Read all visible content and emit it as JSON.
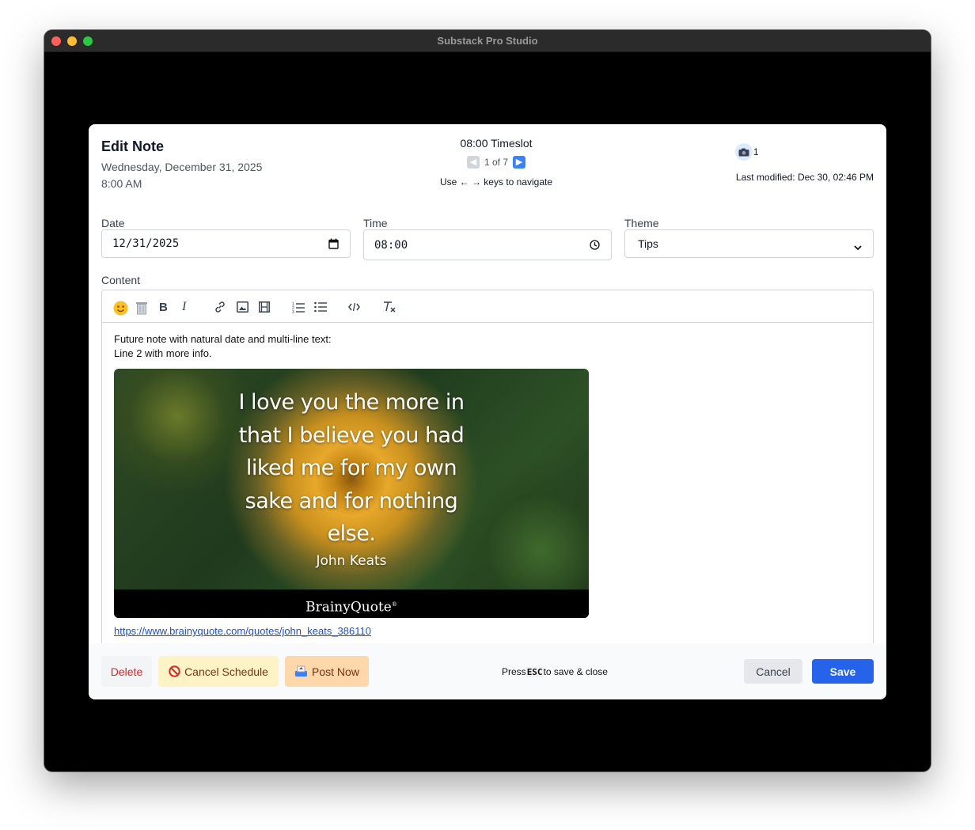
{
  "window": {
    "title": "Substack Pro Studio"
  },
  "header": {
    "title": "Edit Note",
    "date_line": "Wednesday, December 31, 2025",
    "time_line": "8:00 AM",
    "timeslot": "08:00 Timeslot",
    "position": "1 of 7",
    "nav_hint": "Use ← → keys to navigate",
    "media_count": "1",
    "last_modified": "Last modified: Dec 30, 02:46 PM"
  },
  "form": {
    "date_label": "Date",
    "date_value": "12/31/2025",
    "time_label": "Time",
    "time_value": "08:00",
    "theme_label": "Theme",
    "theme_value": "Tips",
    "content_label": "Content"
  },
  "editor": {
    "toolbar": [
      "emoji",
      "delete-image",
      "bold",
      "italic",
      "link",
      "image",
      "video",
      "ordered-list",
      "bullet-list",
      "code",
      "clear-format"
    ],
    "line1": "Future note with natural date and multi-line text:",
    "line2": "Line 2 with more info.",
    "image": {
      "quote_lines": [
        "I love you the more in",
        "that I believe you had",
        "liked me for my own",
        "sake and for nothing",
        "else."
      ],
      "author": "John Keats",
      "brand": "BrainyQuote"
    },
    "link": "https://www.brainyquote.com/quotes/john_keats_386110"
  },
  "footer": {
    "delete": "Delete",
    "cancel_schedule": "Cancel Schedule",
    "post_now": "Post Now",
    "hint_prefix": "Press",
    "hint_key": "ESC",
    "hint_suffix": "to save & close",
    "cancel": "Cancel",
    "save": "Save"
  },
  "colors": {
    "primary": "#2563eb",
    "danger": "#dc2626",
    "warning_bg": "#fef3c7",
    "post_bg": "#fed7aa"
  }
}
